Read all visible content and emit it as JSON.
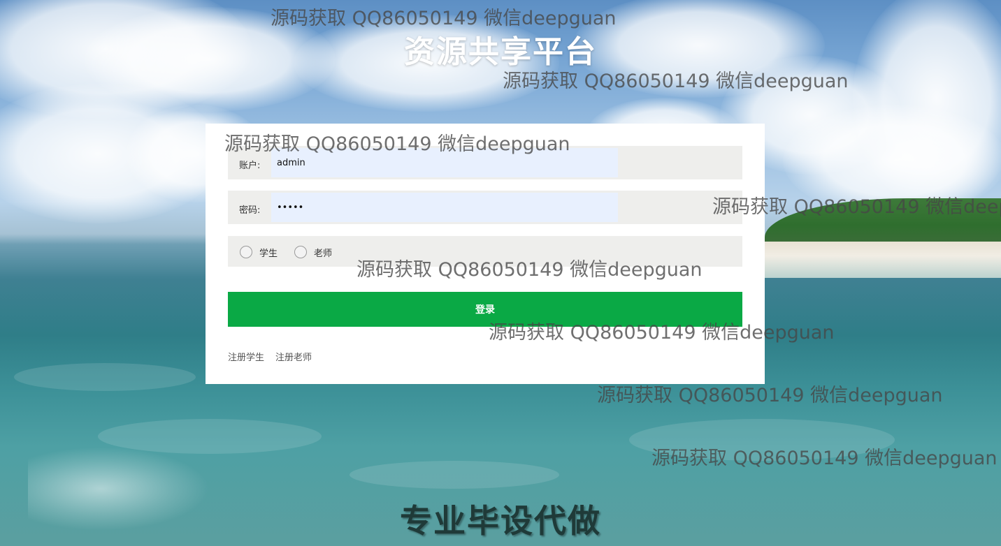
{
  "page": {
    "title": "资源共享平台",
    "footer_banner": "专业毕设代做"
  },
  "login_form": {
    "account_label": "账户:",
    "account_value": "admin",
    "password_label": "密码:",
    "password_value": "admin",
    "roles": [
      {
        "label": "学生",
        "selected": false
      },
      {
        "label": "老师",
        "selected": false
      }
    ],
    "submit_label": "登录",
    "register_links": [
      "注册学生",
      "注册老师"
    ]
  },
  "watermark": {
    "text": "源码获取 QQ86050149 微信deepguan"
  },
  "colors": {
    "primary_button": "#0aa945",
    "input_autofill_bg": "#e8f0fe",
    "field_row_bg": "#eeeeec"
  }
}
